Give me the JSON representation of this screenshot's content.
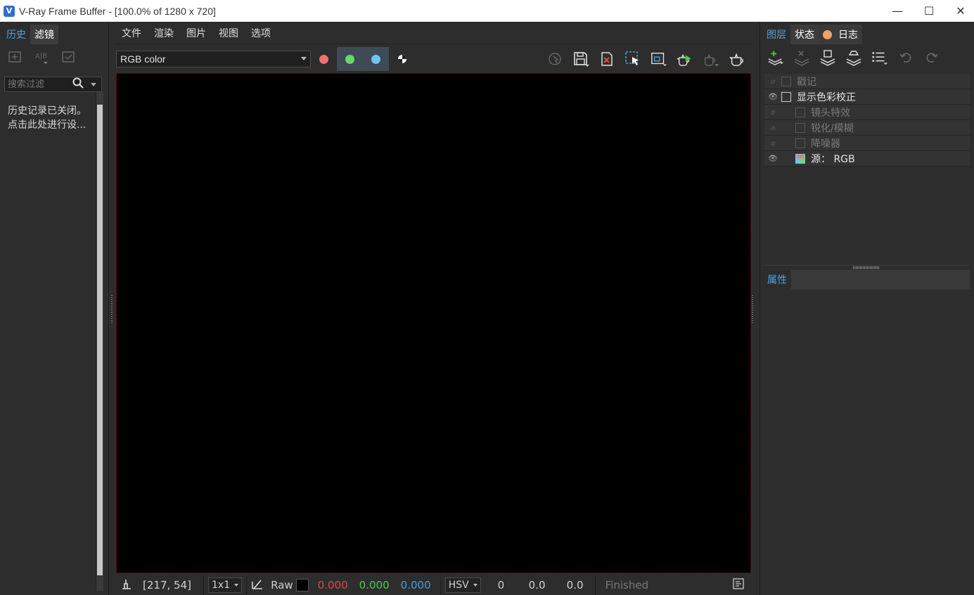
{
  "window": {
    "title": "V-Ray Frame Buffer - [100.0% of 1280 x 720]",
    "app_icon_letter": "V",
    "minimize": "—",
    "maximize": "☐",
    "close": "✕"
  },
  "left_panel": {
    "tabs": [
      {
        "label": "历史"
      },
      {
        "label": "滤镜"
      }
    ],
    "search_placeholder": "搜索过滤",
    "history_message_line1": "历史记录已关闭。",
    "history_message_line2": "点击此处进行设..."
  },
  "menu": {
    "items": [
      "文件",
      "渲染",
      "图片",
      "视图",
      "选项"
    ]
  },
  "toolbar": {
    "channel": "RGB color",
    "channel_colors": {
      "red": "#f07070",
      "green": "#6bd66b",
      "blue": "#6fc3f0"
    }
  },
  "status": {
    "coords": "[217, 54]",
    "zoom": "1x1",
    "mode": "Raw",
    "r": "0.000",
    "g": "0.000",
    "b": "0.000",
    "colorspace": "HSV",
    "h": "0",
    "s": "0.0",
    "v": "0.0",
    "state": "Finished",
    "colors": {
      "r": "#e04848",
      "g": "#4cc94c",
      "b": "#4a9de0"
    }
  },
  "right_panel": {
    "tabs": [
      {
        "label": "图层"
      },
      {
        "label": "状态"
      },
      {
        "label": "日志"
      }
    ],
    "layers": [
      {
        "label": "戳记",
        "visible": false,
        "indent": 0
      },
      {
        "label": "显示色彩校正",
        "visible": true,
        "indent": 0
      },
      {
        "label": "镜头特效",
        "visible": false,
        "indent": 1
      },
      {
        "label": "锐化/模糊",
        "visible": false,
        "indent": 1
      },
      {
        "label": "降噪器",
        "visible": false,
        "indent": 1
      },
      {
        "label": "源： RGB",
        "visible": true,
        "indent": 1
      }
    ],
    "properties_label": "属性"
  }
}
